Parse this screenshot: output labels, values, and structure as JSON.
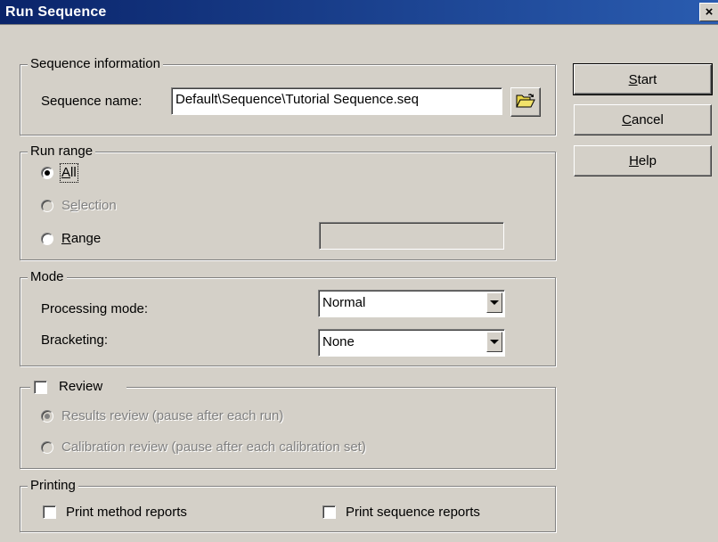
{
  "window": {
    "title": "Run Sequence",
    "close_glyph": "×"
  },
  "sequence_info": {
    "group_title": "Sequence information",
    "name_label": "Sequence name:",
    "name_value": "Default\\Sequence\\Tutorial Sequence.seq",
    "browse_icon": "folder-open-icon"
  },
  "run_range": {
    "group_title": "Run range",
    "all_pre": "",
    "all_mn": "A",
    "all_post": "ll",
    "selection_pre": "S",
    "selection_mn": "e",
    "selection_post": "lection",
    "range_pre": "",
    "range_mn": "R",
    "range_post": "ange",
    "range_value": "",
    "selected": "All"
  },
  "mode": {
    "group_title": "Mode",
    "processing_label": "Processing mode:",
    "processing_value": "Normal",
    "bracketing_label": "Bracketing:",
    "bracketing_value": "None"
  },
  "review": {
    "group_title": "Review",
    "checked": false,
    "results_label": "Results review (pause after each run)",
    "calibration_label": "Calibration review (pause after each calibration set)",
    "selected": "Results review"
  },
  "printing": {
    "group_title": "Printing",
    "method_label": "Print method reports",
    "sequence_label": "Print sequence reports",
    "method_checked": false,
    "sequence_checked": false
  },
  "buttons": {
    "start_mn": "S",
    "start_rest": "tart",
    "cancel_mn": "C",
    "cancel_rest": "ancel",
    "help_mn": "H",
    "help_rest": "elp"
  }
}
